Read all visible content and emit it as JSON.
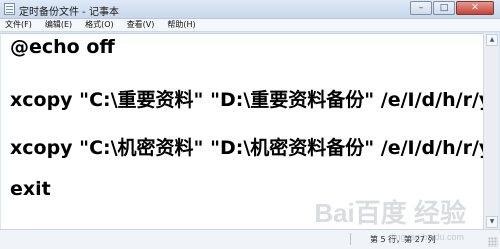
{
  "window": {
    "title": "定时备份文件 - 记事本",
    "controls": {
      "minimize": "–",
      "maximize": "□",
      "close": "✕"
    }
  },
  "menu": {
    "items": [
      "文件(F)",
      "编辑(E)",
      "格式(O)",
      "查看(V)",
      "帮助(H)"
    ]
  },
  "editor": {
    "lines": [
      "@echo off",
      "xcopy \"C:\\重要资料\" \"D:\\重要资料备份\" /e/I/d/h/r/y",
      "xcopy \"C:\\机密资料\" \"D:\\机密资料备份\" /e/I/d/h/r/y",
      "exit"
    ]
  },
  "statusbar": {
    "position": "第 5 行，第 27 列"
  },
  "watermark": {
    "text": "Bai百度 经验",
    "sub": "jingyan.baidu.com"
  },
  "icons": {
    "app": "notepad-icon",
    "scroll_up": "scroll-up-arrow-icon",
    "scroll_down": "scroll-down-arrow-icon"
  }
}
